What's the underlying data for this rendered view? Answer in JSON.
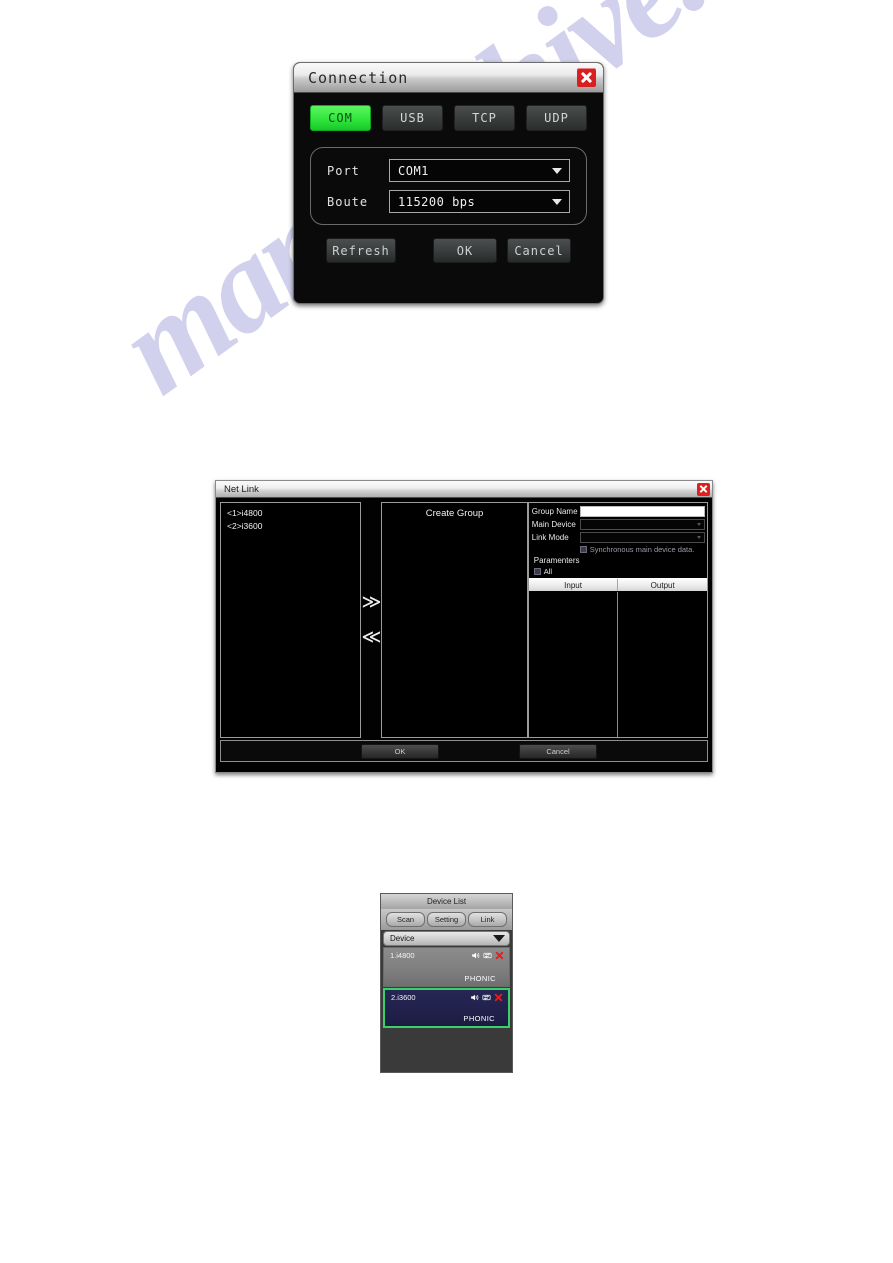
{
  "watermark": {
    "text": "manualshive.com",
    "color": "#c9c9ea"
  },
  "connection_dialog": {
    "title": "Connection",
    "close_icon": "close-icon",
    "tabs": [
      {
        "label": "COM",
        "active": true
      },
      {
        "label": "USB",
        "active": false
      },
      {
        "label": "TCP",
        "active": false
      },
      {
        "label": "UDP",
        "active": false
      }
    ],
    "active_tab_color": "#34e83f",
    "fields": [
      {
        "label": "Port",
        "value": "COM1"
      },
      {
        "label": "Boute",
        "value": "115200 bps"
      }
    ],
    "buttons": {
      "refresh": "Refresh",
      "ok": "OK",
      "cancel": "Cancel"
    }
  },
  "net_link_dialog": {
    "title": "Net Link",
    "close_icon": "close-icon",
    "device_list": [
      "<1>i4800",
      "<2>i3600"
    ],
    "arrows": {
      "add": "≫",
      "remove": "≪"
    },
    "group_panel": {
      "title": "Create Group"
    },
    "form": {
      "group_name_label": "Group Name",
      "group_name_value": "",
      "main_device_label": "Main Device",
      "main_device_value": "",
      "link_mode_label": "Link Mode",
      "link_mode_value": "",
      "sync_checkbox_label": "Synchronous main device data.",
      "sync_checked": true,
      "parameters_label": "Paramenters",
      "all_label": "All",
      "all_checked": true
    },
    "table": {
      "columns": [
        "Input",
        "Output"
      ],
      "rows": []
    },
    "buttons": {
      "ok": "OK",
      "cancel": "Cancel"
    }
  },
  "device_list_panel": {
    "title": "Device List",
    "buttons": [
      {
        "label": "Scan"
      },
      {
        "label": "Setting"
      },
      {
        "label": "Link"
      }
    ],
    "filter": {
      "value": "Device",
      "icon": "chevron-down-icon"
    },
    "devices": [
      {
        "name": "1.i4800",
        "brand": "PHONIC",
        "selected": false,
        "icons": [
          "speaker-icon",
          "sync-icon",
          "close-icon"
        ]
      },
      {
        "name": "2.i3600",
        "brand": "PHONIC",
        "selected": true,
        "icons": [
          "speaker-icon",
          "sync-icon",
          "close-icon"
        ]
      }
    ],
    "selected_border_color": "#39cf6a",
    "selected_background": "#21214c"
  }
}
